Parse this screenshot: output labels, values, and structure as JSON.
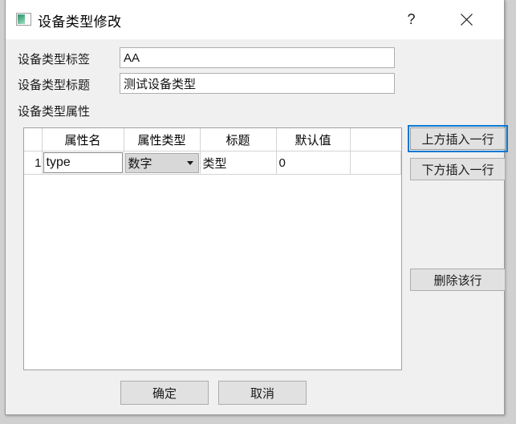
{
  "window": {
    "title": "设备类型修改",
    "icon": "picture-icon",
    "controls": {
      "help_label": "?",
      "close_label": "✕"
    }
  },
  "form": {
    "tag": {
      "label": "设备类型标签",
      "value": "AA",
      "placeholder": ""
    },
    "title": {
      "label": "设备类型标题",
      "value": "测试设备类型",
      "placeholder": ""
    },
    "properties_label": "设备类型属性"
  },
  "table": {
    "columns": [
      "属性名",
      "属性类型",
      "标题",
      "默认值"
    ],
    "rows": [
      {
        "index": "1",
        "name": "type",
        "type": "数字",
        "title": "类型",
        "default": "0"
      }
    ]
  },
  "side_buttons": {
    "insert_above": "上方插入一行",
    "insert_below": "下方插入一行",
    "delete_row": "删除该行"
  },
  "bottom_buttons": {
    "ok": "确定",
    "cancel": "取消"
  },
  "colors": {
    "focus_ring": "#0a78d4",
    "window_bg": "#f0f0f0",
    "titlebar_bg": "#ffffff",
    "button_bg": "#e1e1e1",
    "combo_bg": "#d8d8d8"
  }
}
